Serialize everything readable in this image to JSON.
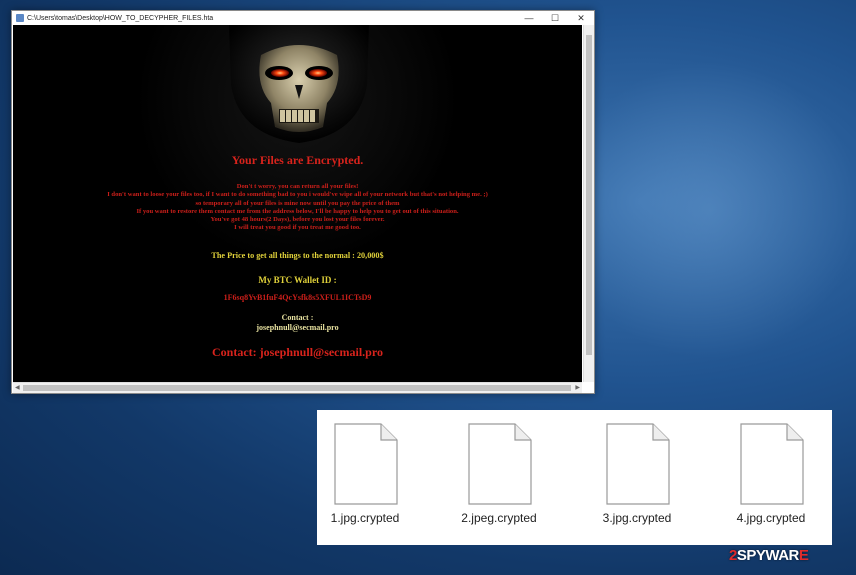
{
  "window": {
    "title": "C:\\Users\\tomas\\Desktop\\HOW_TO_DECYPHER_FILES.hta",
    "minimize_glyph": "—",
    "maximize_glyph": "☐",
    "close_glyph": "✕"
  },
  "note": {
    "title": "Your Files are Encrypted.",
    "body_lines": [
      "Don't t worry, you can return all your files!",
      "I don't want to loose your files too, if I want to do something bad to you i would've wipe all of your network but that's not helping me. ;)",
      "so temporary all of your files is mine now until you pay the price of them",
      "If you want to restore them contact me from the address below, I'll be happy to help you to get out of this situation.",
      "You've got 48 hours(2 Days), before you lost your files forever.",
      "I will treat you good if you treat me good too."
    ],
    "price": "The Price to get all things to the normal : 20,000$",
    "wallet_label": "My BTC Wallet ID :",
    "wallet_id": "1F6sq8YvB1fuF4QcYsfk8s5XFUL1ICTsD9",
    "contact_label": "Contact :",
    "contact_email": "josephnull@secmail.pro",
    "contact_line": "Contact: josephnull@secmail.pro"
  },
  "files": [
    {
      "name": "1.jpg.crypted"
    },
    {
      "name": "2.jpeg.crypted"
    },
    {
      "name": "3.jpg.crypted"
    },
    {
      "name": "4.jpg.crypted"
    }
  ],
  "watermark": {
    "part1": "2",
    "part2": "SPYWAR",
    "part3": "E"
  },
  "colors": {
    "accent_red": "#d8231c",
    "accent_yellow": "#e0d13a",
    "desktop_blue": "#20538f"
  }
}
